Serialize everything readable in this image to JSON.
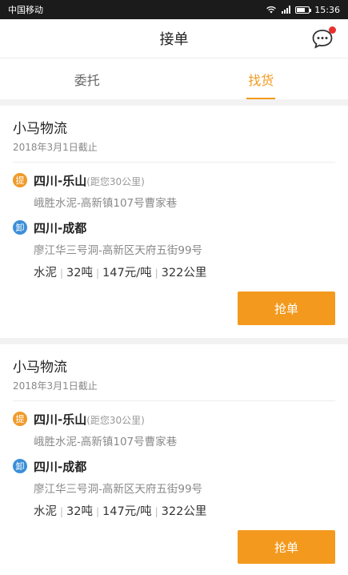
{
  "status_bar": {
    "carrier": "中国移动",
    "time": "15:36"
  },
  "header": {
    "title": "接单",
    "message_icon": "chat-bubble-icon"
  },
  "tabs": [
    {
      "label": "委托",
      "active": false
    },
    {
      "label": "找货",
      "active": true
    }
  ],
  "orders": [
    {
      "company": "小马物流",
      "deadline": "2018年3月1日截止",
      "pickup": {
        "badge": "提",
        "route": "四川-乐山",
        "distance": "(距您30公里)",
        "address": "峨胜水泥-高新镇107号曹家巷"
      },
      "dropoff": {
        "badge": "卸",
        "route": "四川-成都",
        "address": "廖江华三号洞-高新区天府五街99号"
      },
      "meta": {
        "goods": "水泥",
        "weight": "32吨",
        "price": "147元/吨",
        "distance": "322公里"
      },
      "button": "抢单"
    },
    {
      "company": "小马物流",
      "deadline": "2018年3月1日截止",
      "pickup": {
        "badge": "提",
        "route": "四川-乐山",
        "distance": "(距您30公里)",
        "address": "峨胜水泥-高新镇107号曹家巷"
      },
      "dropoff": {
        "badge": "卸",
        "route": "四川-成都",
        "address": "廖江华三号洞-高新区天府五街99号"
      },
      "meta": {
        "goods": "水泥",
        "weight": "32吨",
        "price": "147元/吨",
        "distance": "322公里"
      },
      "button": "抢单"
    }
  ],
  "colors": {
    "accent": "#f39a1e",
    "pickup_badge": "#f09a28",
    "dropoff_badge": "#3b8fd9"
  }
}
